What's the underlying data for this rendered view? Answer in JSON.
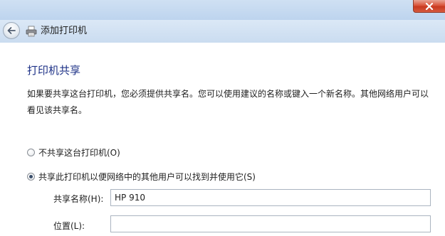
{
  "window": {
    "close_icon": "close-icon",
    "accent_color": "#c8391f"
  },
  "nav": {
    "back_icon": "back-arrow-icon",
    "printer_icon": "printer-icon",
    "title": "添加打印机"
  },
  "page": {
    "title": "打印机共享",
    "description": "如果要共享这台打印机，您必须提供共享名。您可以使用建议的名称或键入一个新名称。其他网络用户可以看见该共享名。"
  },
  "options": {
    "no_share": {
      "label": "不共享这台打印机(O)",
      "selected": false
    },
    "share": {
      "label": "共享此打印机以便网络中的其他用户可以找到并使用它(S)",
      "selected": true
    }
  },
  "fields": {
    "share_name": {
      "label": "共享名称(H):",
      "value": "HP 910"
    },
    "location": {
      "label": "位置(L):",
      "value": ""
    }
  }
}
